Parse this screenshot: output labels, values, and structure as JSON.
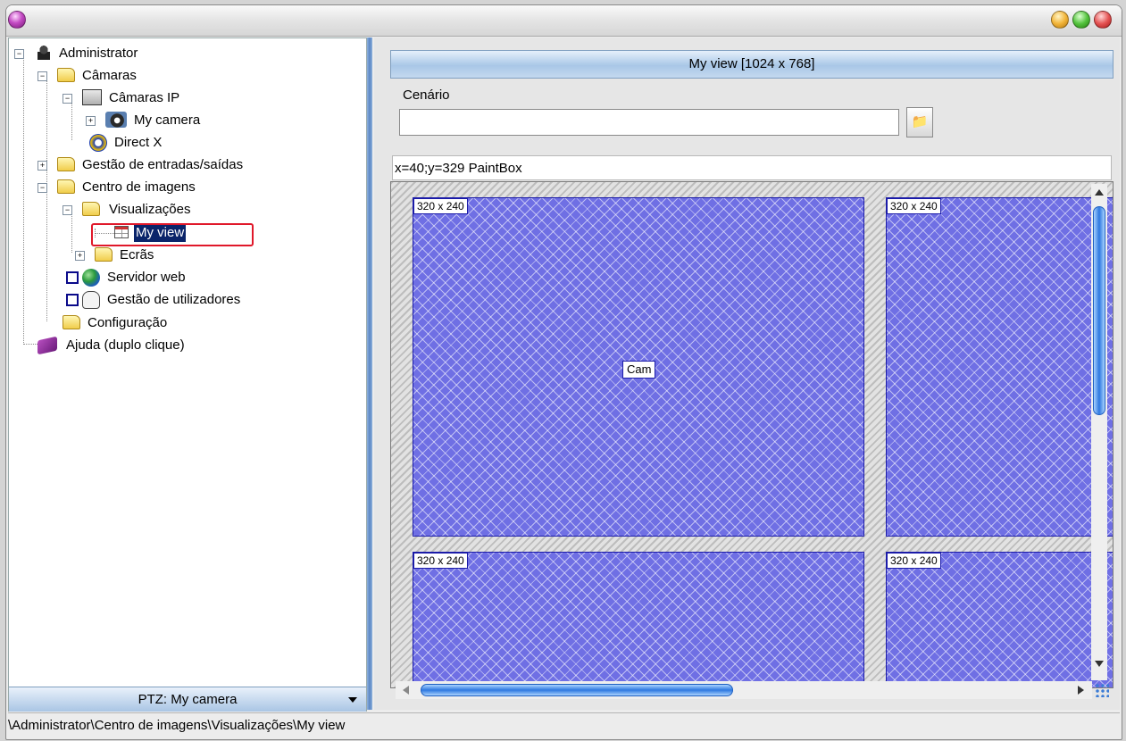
{
  "tree": {
    "items": [
      {
        "label": "Administrator"
      },
      {
        "label": "Câmaras"
      },
      {
        "label": "Câmaras IP"
      },
      {
        "label": "My camera"
      },
      {
        "label": "Direct X"
      },
      {
        "label": "Gestão de entradas/saídas"
      },
      {
        "label": "Centro de imagens"
      },
      {
        "label": "Visualizações"
      },
      {
        "label": "My view"
      },
      {
        "label": "Ecrãs"
      },
      {
        "label": "Servidor web"
      },
      {
        "label": "Gestão de utilizadores"
      },
      {
        "label": "Configuração"
      },
      {
        "label": "Ajuda (duplo clique)"
      }
    ]
  },
  "ptz": {
    "label": "PTZ: My camera"
  },
  "panel": {
    "title": "My view [1024 x 768]",
    "scenario_label": "Cenário",
    "scenario_value": "",
    "folder_icon": "📁",
    "coords": "x=40;y=329 PaintBox",
    "cells": [
      {
        "size": "320 x 240"
      },
      {
        "size": "320 x 240"
      },
      {
        "size": "320 x 240"
      },
      {
        "size": "320 x 240"
      }
    ],
    "cam_label": "Cam"
  },
  "status": {
    "path": "\\Administrator\\Centro de imagens\\Visualizações\\My view"
  },
  "colors": {
    "selection": "#0a246a",
    "highlight_box": "#e0182a",
    "cell_fill": "#6f6fe4",
    "accent": "#2e78e0"
  }
}
